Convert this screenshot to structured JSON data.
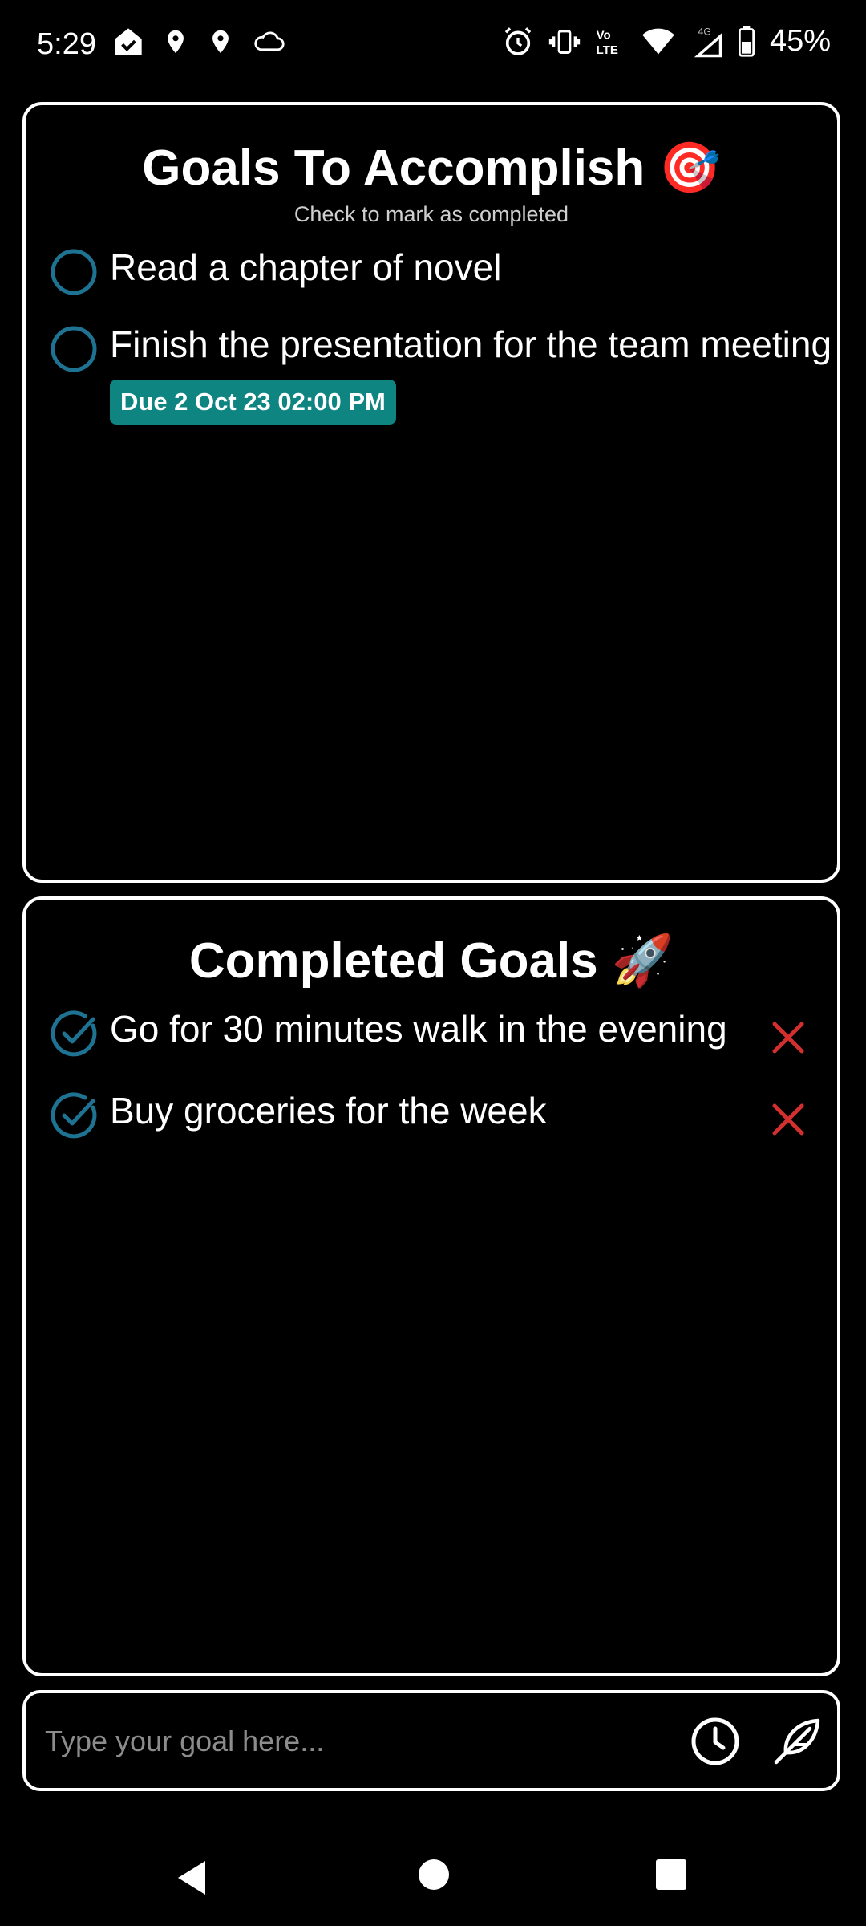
{
  "status_bar": {
    "time": "5:29",
    "battery": "45%",
    "left_icons": [
      "home-check-icon",
      "location-icon",
      "location-icon",
      "cloud-icon"
    ],
    "right_icons": [
      "alarm-icon",
      "vibrate-icon",
      "volte-icon",
      "wifi-icon",
      "signal-4g-icon",
      "battery-icon"
    ]
  },
  "goals_card": {
    "title": "Goals To Accomplish 🎯",
    "subtitle": "Check to mark as completed",
    "items": [
      {
        "text": "Read a chapter of novel",
        "due": ""
      },
      {
        "text": "Finish the presentation for the team meeting",
        "due": "Due 2 Oct 23 02:00 PM"
      }
    ]
  },
  "completed_card": {
    "title": "Completed Goals 🚀",
    "items": [
      {
        "text": "Go for 30 minutes walk in the evening"
      },
      {
        "text": "Buy groceries for the week"
      }
    ]
  },
  "input_bar": {
    "placeholder": "Type your goal here...",
    "value": ""
  },
  "colors": {
    "accent_teal": "#0e8581",
    "check_blue": "#1e7393",
    "remove_red": "#d32f2f",
    "border": "#ffffff",
    "background": "#000000"
  }
}
